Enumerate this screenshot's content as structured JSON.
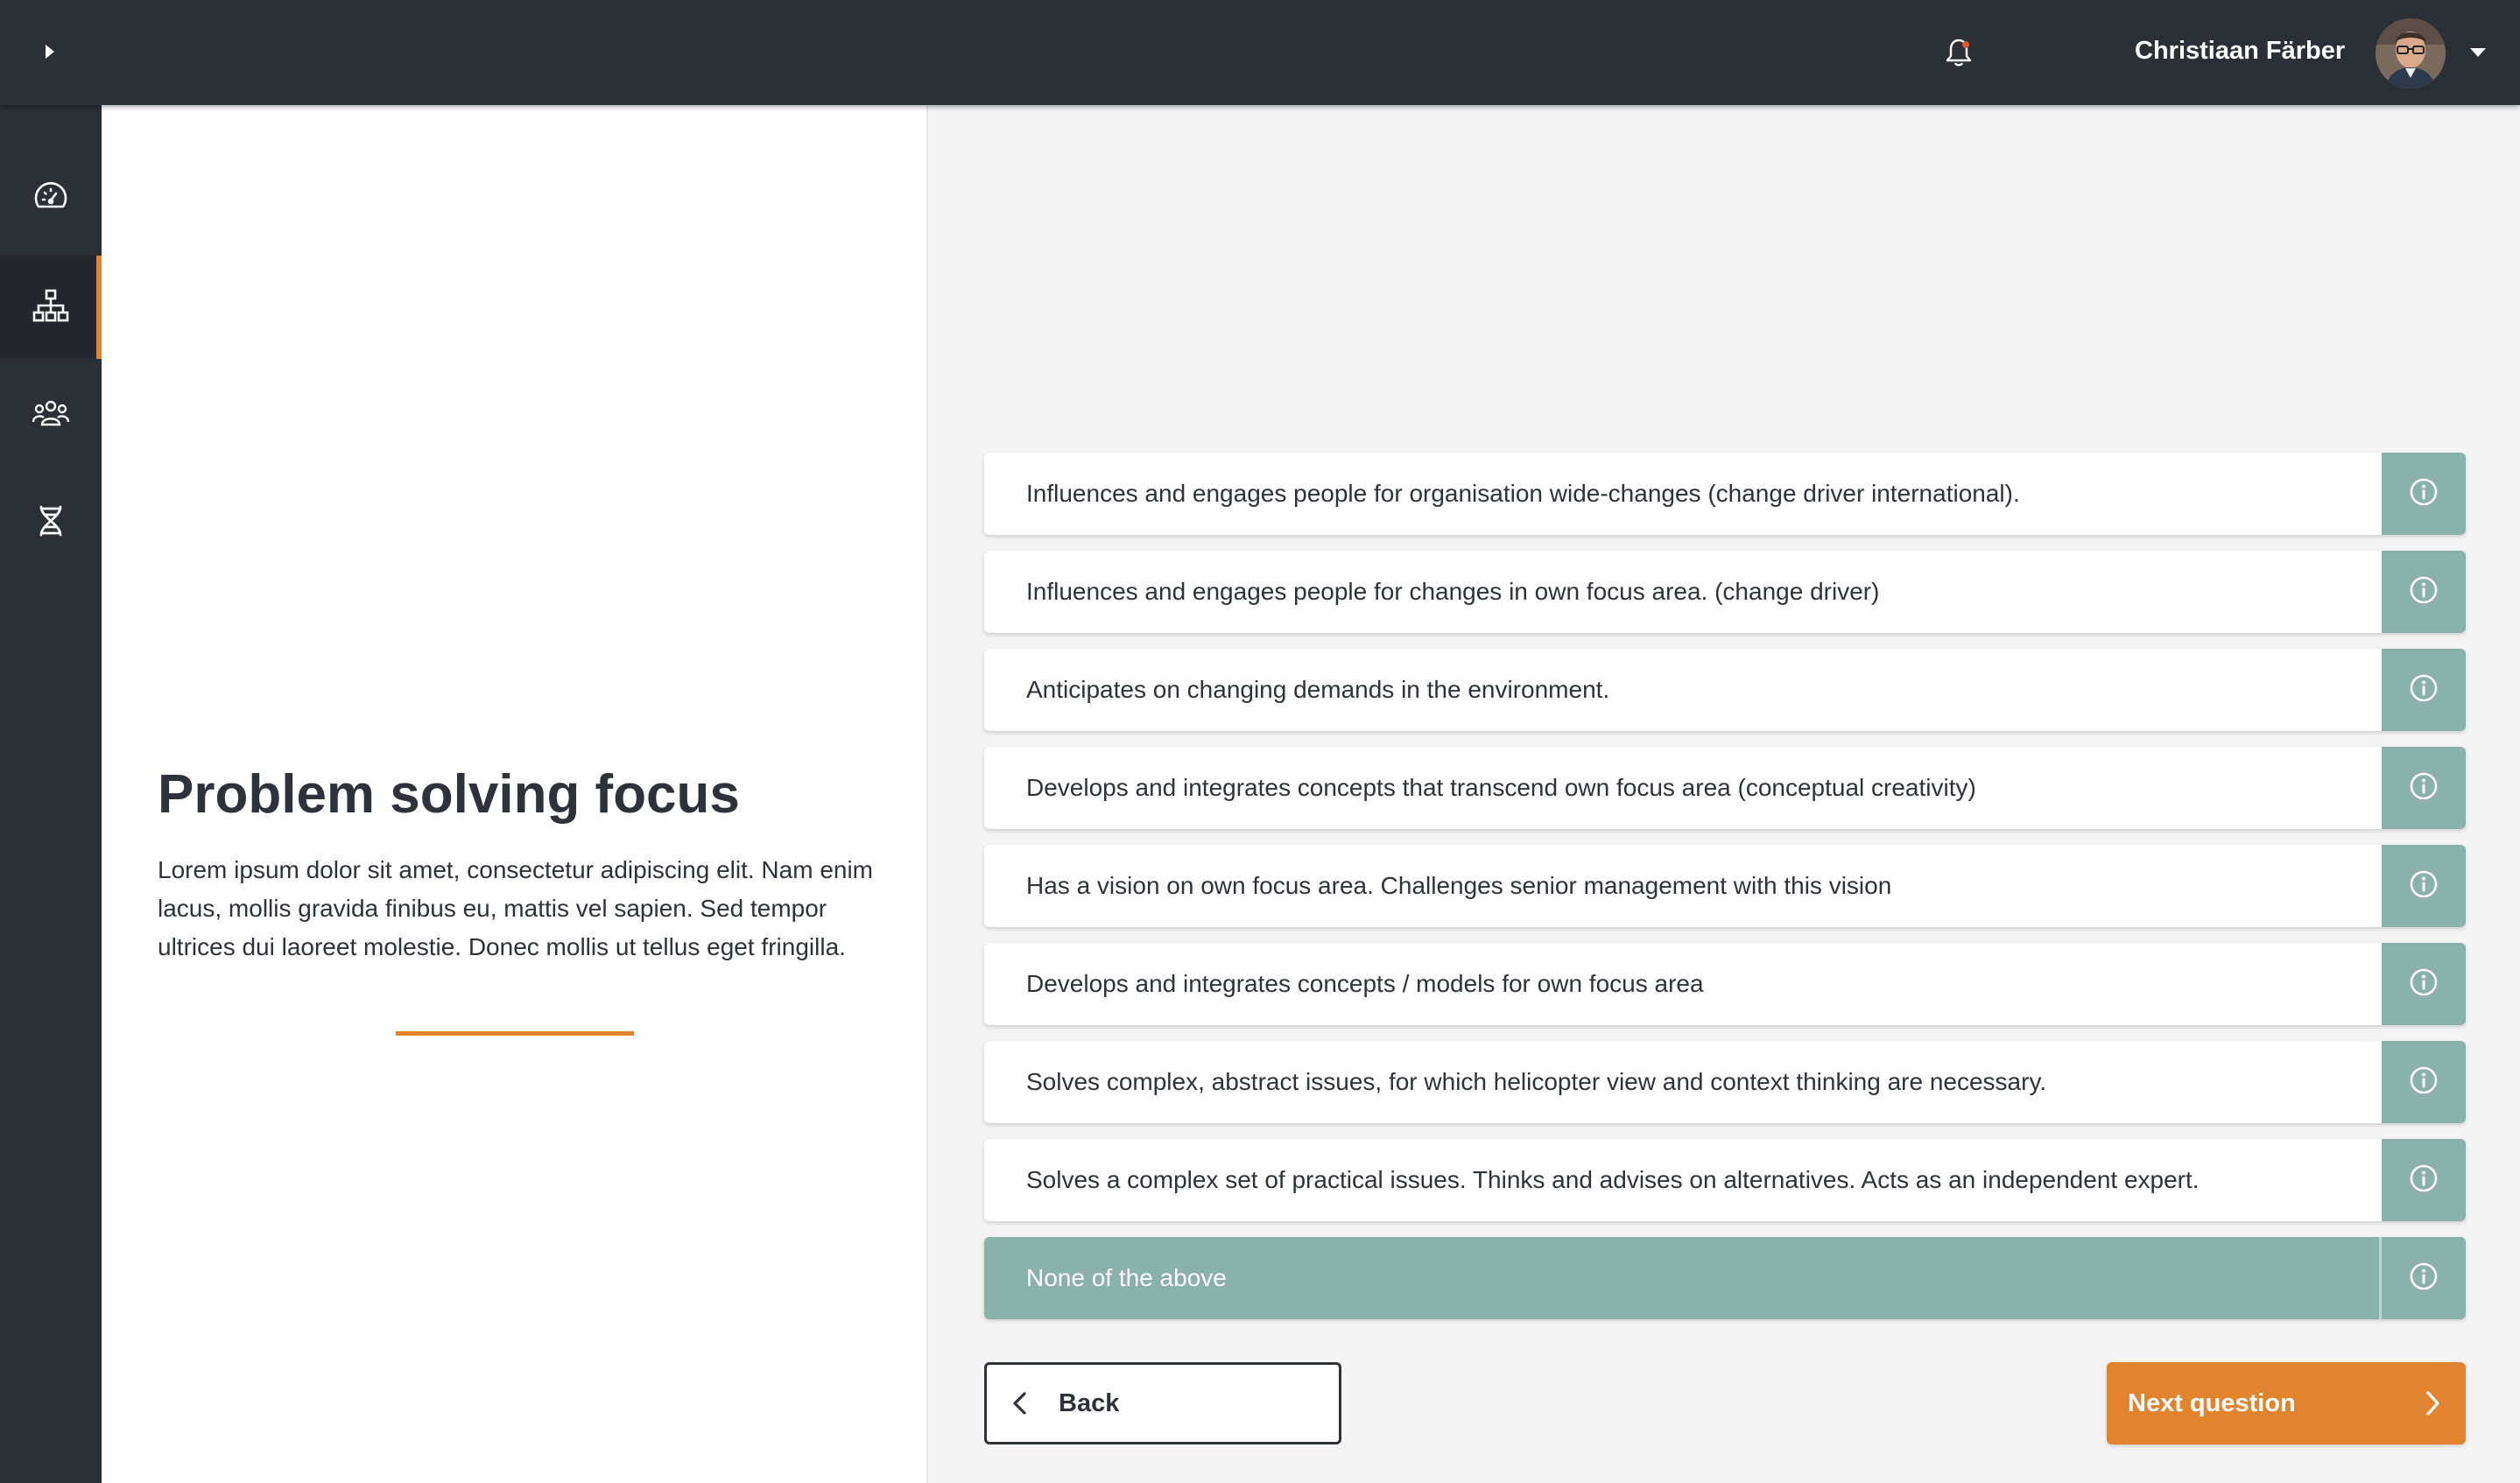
{
  "header": {
    "menu_toggle_icon": "chevron-right-icon",
    "notification_icon": "bell-icon",
    "user_name": "Christiaan Färber",
    "dropdown_icon": "caret-down-icon"
  },
  "sidebar": {
    "items": [
      {
        "icon": "dashboard-gauge-icon",
        "active": false
      },
      {
        "icon": "org-chart-icon",
        "active": true
      },
      {
        "icon": "people-group-icon",
        "active": false
      },
      {
        "icon": "dna-icon",
        "active": false
      }
    ]
  },
  "question": {
    "title": "Problem solving focus",
    "description": "Lorem ipsum dolor sit amet, consectetur adipiscing elit. Nam enim lacus, mollis gravida finibus eu, mattis vel sapien. Sed tempor ultrices dui laoreet molestie. Donec mollis ut tellus eget fringilla."
  },
  "options": [
    {
      "label": "Influences and engages people for organisation wide-changes (change driver international).",
      "selected": false
    },
    {
      "label": "Influences and engages people for changes in own focus area. (change driver)",
      "selected": false
    },
    {
      "label": "Anticipates on changing demands in the environment.",
      "selected": false
    },
    {
      "label": "Develops and integrates concepts that transcend own focus area (conceptual creativity)",
      "selected": false
    },
    {
      "label": "Has a vision on own focus area. Challenges senior management with this vision",
      "selected": false
    },
    {
      "label": "Develops and integrates concepts / models for own focus area",
      "selected": false
    },
    {
      "label": "Solves complex, abstract issues, for which helicopter view and context thinking are necessary.",
      "selected": false
    },
    {
      "label": "Solves a complex set of practical issues. Thinks and advises on alternatives. Acts as an independent expert.",
      "selected": false
    },
    {
      "label": "None of the above",
      "selected": true
    }
  ],
  "actions": {
    "back_label": "Back",
    "next_label": "Next question"
  },
  "colors": {
    "topbar": "#2b3037",
    "accent_orange": "#e2832e",
    "teal": "#89b2ab",
    "page_bg": "#f4f4f4"
  }
}
